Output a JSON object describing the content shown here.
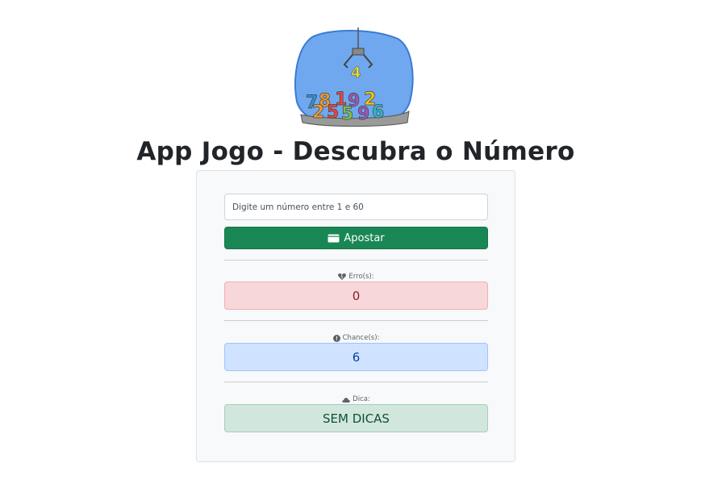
{
  "app": {
    "title": "App Jogo - Descubra o Número",
    "logo_icon": "claw-machine-numbers-logo",
    "logo_digits": [
      "4",
      "7",
      "8",
      "1",
      "9",
      "2",
      "2",
      "5",
      "5",
      "9",
      "6"
    ]
  },
  "form": {
    "input_placeholder": "Digite um número entre 1 e 60",
    "input_value": "",
    "bet_button_label": "Apostar",
    "bet_button_icon": "wallet-icon"
  },
  "stats": {
    "errors": {
      "label": "Erro(s):",
      "value": "0",
      "icon": "heartbreak-icon"
    },
    "chances": {
      "label": "Chance(s):",
      "value": "6",
      "icon": "exclamation-circle-icon"
    },
    "hint": {
      "label": "Dica:",
      "value": "SEM DICAS",
      "icon": "cloud-icon"
    }
  },
  "colors": {
    "button_success": "#198754",
    "errors_bg": "#f8d7da",
    "errors_text": "#842029",
    "chances_bg": "#cfe2ff",
    "chances_text": "#084298",
    "hint_bg": "#d1e7dd",
    "hint_text": "#0f5132",
    "card_bg": "#f8f9fa"
  }
}
